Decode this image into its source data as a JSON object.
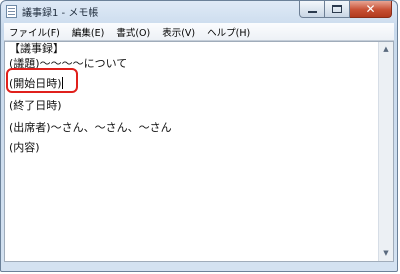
{
  "window": {
    "title": "議事録1 - メモ帳",
    "controls": {
      "minimize": "",
      "maximize": "",
      "close": "✕"
    }
  },
  "menu": [
    {
      "label": "ファイル(F)"
    },
    {
      "label": "編集(E)"
    },
    {
      "label": "書式(O)"
    },
    {
      "label": "表示(V)"
    },
    {
      "label": "ヘルプ(H)"
    }
  ],
  "document": {
    "lines": [
      "【議事録】",
      "(議題)〜〜〜〜について",
      "(開始日時)",
      "(終了日時)",
      "(出席者)〜さん、〜さん、〜さん",
      "(内容)"
    ],
    "highlighted_line": 3,
    "highlight_color": "#e0201c"
  },
  "scrollbar": {
    "up_icon": "▲",
    "down_icon": "▼"
  }
}
